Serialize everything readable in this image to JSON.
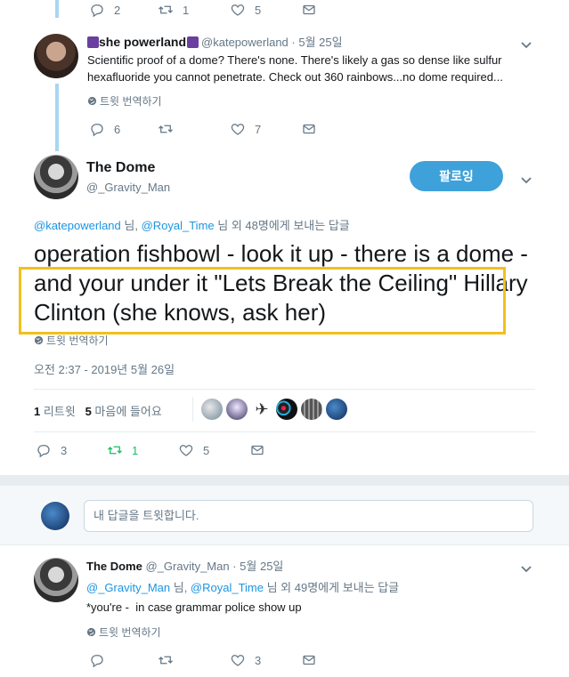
{
  "top_actions": {
    "replies": "2",
    "retweets": "1",
    "likes": "5"
  },
  "reply1": {
    "display_name": "she powerland",
    "handle": "@katepowerland",
    "date": "· 5월 25일",
    "text_line1": "Scientific proof of a dome? There's none. There's likely a gas so dense like sulfur",
    "text_line2": "hexafluoride you cannot penetrate. Check out 360 rainbows...no dome required...",
    "translate": "트윗 번역하기",
    "replies": "6",
    "likes": "7"
  },
  "main_tweet": {
    "display_name": "The Dome",
    "handle": "@_Gravity_Man",
    "follow_label": "팔로잉",
    "reply_to_user1": "@katepowerland",
    "reply_to_sep": " 님, ",
    "reply_to_user2": "@Royal_Time",
    "reply_to_rest": " 님 외 48명에게 보내는 답글",
    "text": "operation fishbowl - look it up - there is a dome - and your under it \"Lets Break the Ceiling\" Hillary Clinton (she knows, ask her)",
    "translate": "트윗 번역하기",
    "timestamp": "오전 2:37 - 2019년 5월 26일",
    "retweet_count": "1",
    "retweet_label": " 리트윗",
    "like_count": "5",
    "like_label": " 마음에 들어요",
    "replies": "3",
    "retweets": "1",
    "likes": "5"
  },
  "compose": {
    "placeholder": "내 답글을 트윗합니다."
  },
  "reply2": {
    "display_name": "The Dome",
    "handle": "@_Gravity_Man",
    "date": "· 5월 25일",
    "reply_to_user1": "@_Gravity_Man",
    "reply_to_sep": " 님, ",
    "reply_to_user2": "@Royal_Time",
    "reply_to_rest": " 님 외 49명에게 보내는 답글",
    "text": "*you're -  in case grammar police show up",
    "translate": "트윗 번역하기",
    "likes": "3"
  },
  "colors": {
    "link": "#1b95e0",
    "follow": "#3ea1da",
    "highlight": "#f2c01e",
    "retweet_active": "#17bf63"
  }
}
